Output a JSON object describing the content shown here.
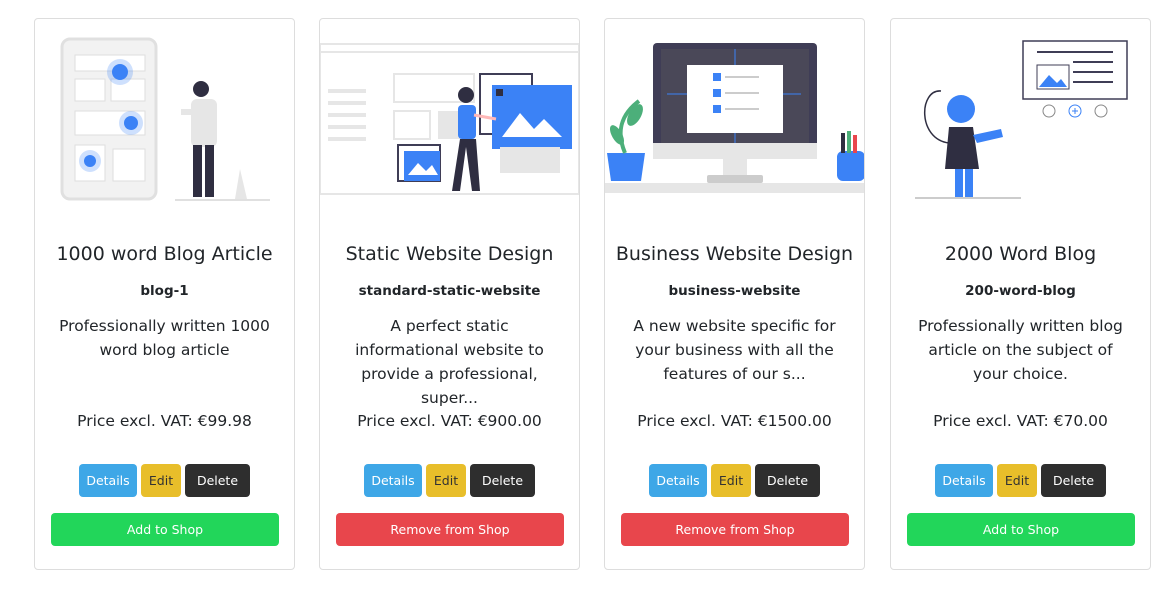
{
  "products": [
    {
      "title": "1000 word Blog Article",
      "slug": "blog-1",
      "description": "Professionally written 1000 word blog article",
      "price": "Price excl. VAT: €99.98",
      "details_label": "Details",
      "edit_label": "Edit",
      "delete_label": "Delete",
      "shop_label": "Add to Shop",
      "in_shop": false
    },
    {
      "title": "Static Website Design",
      "slug": "standard-static-website",
      "description": "A perfect static informational website to provide a professional, super...",
      "price": "Price excl. VAT: €900.00",
      "details_label": "Details",
      "edit_label": "Edit",
      "delete_label": "Delete",
      "shop_label": "Remove from Shop",
      "in_shop": true
    },
    {
      "title": "Business Website Design",
      "slug": "business-website",
      "description": "A new website specific for your business with all the features of our s...",
      "price": "Price excl. VAT: €1500.00",
      "details_label": "Details",
      "edit_label": "Edit",
      "delete_label": "Delete",
      "shop_label": "Remove from Shop",
      "in_shop": true
    },
    {
      "title": "2000 Word Blog",
      "slug": "200-word-blog",
      "description": "Professionally written blog article on the subject of your choice.",
      "price": "Price excl. VAT: €70.00",
      "details_label": "Details",
      "edit_label": "Edit",
      "delete_label": "Delete",
      "shop_label": "Add to Shop",
      "in_shop": false
    }
  ],
  "colors": {
    "details": "#3ea7e7",
    "edit": "#e8be2a",
    "delete": "#2e2e2e",
    "add_to_shop": "#22d65a",
    "remove_from_shop": "#e8464c",
    "illustration_accent": "#3b82f6"
  },
  "icons": [
    "blog-illustration",
    "web-design-illustration",
    "desktop-illustration",
    "presentation-illustration"
  ]
}
